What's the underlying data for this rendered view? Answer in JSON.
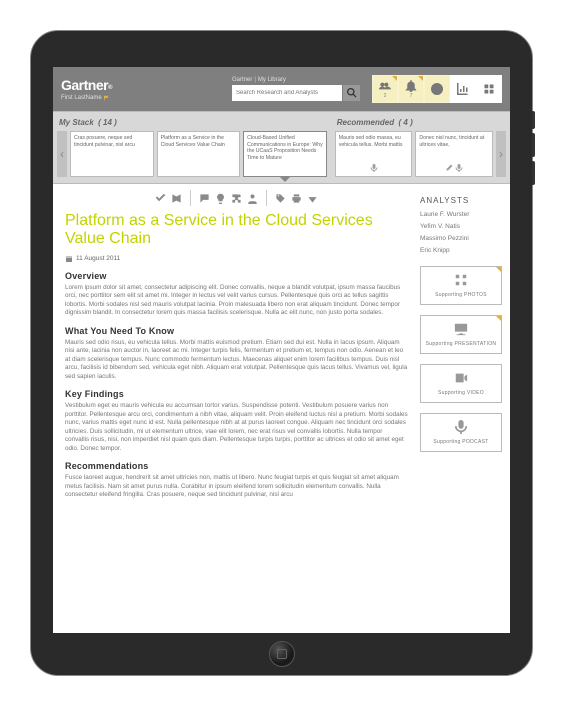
{
  "brand": "Gartner",
  "brandSub": "®",
  "user": "First LastName",
  "breadcrumb": {
    "a": "Gartner",
    "b": "My Library"
  },
  "search": {
    "placeholder": "Search Research and Analysts"
  },
  "topIcons": [
    {
      "name": "people-icon",
      "count": "2"
    },
    {
      "name": "bell-icon",
      "count": "7"
    },
    {
      "name": "clock-icon",
      "count": ""
    },
    {
      "name": "chart-icon",
      "count": ""
    },
    {
      "name": "grid-icon",
      "count": ""
    }
  ],
  "myStack": {
    "title": "My Stack",
    "count": "( 14 )",
    "cards": [
      "Cras posuere, neque sed tincidunt pulvinar, nisl arcu",
      "Platform as a Service in the Cloud Services Value Chain",
      "Cloud-Based Unified Communications in Europe: Why the UCaaS Proposition Needs Time to Mature"
    ]
  },
  "recommended": {
    "title": "Recommended",
    "count": "( 4 )",
    "cards": [
      "Mauris sed odio massa, eu vehicula tellus. Morbi mattis",
      "Donec nisl nunc, tincidunt at ultrices vitae,"
    ]
  },
  "article": {
    "title": "Platform as a Service in the Cloud Services Value Chain",
    "date": "11 August 2011",
    "sections": {
      "overview": {
        "h": "Overview",
        "p": "Lorem ipsum dolor sit amet, consectetur adipiscing elit. Donec convallis, neque a blandit volutpat, ipsum massa faucibus orci, nec porttitor sem elit sit amet mi. Integer in lectus vel velit varius cursus. Pellentesque quis orci ac tellus sagittis lobortis. Morbi sodales nisl sed mauris volutpat lacinia. Proin malesuada libero non erat aliquam tincidunt. Donec tempor dignissim blandit. In consectetur lorem quis massa facilisis scelerisque. Nulla ac elit nunc, non justo porta sodales."
      },
      "whatYouNeed": {
        "h": "What You Need To Know",
        "p": "Mauris sed odio risus, eu vehicula tellus. Morbi mattis euismod pretium. Etiam sed dui est. Nulla in lacus ipsum. Aliquam nisi ante, lacinia non auctor in, laoreet ac mi. Integer turpis felis, fermentum et pretium et, tempus non odio. Aenean et leo at diam scelerisque tempus. Nunc commodo fermentum lectus. Maecenas aliquet enim lorem facilibus tempus. Duis nisl arcu, facilisis id bibendum sed, vehicula eget nibh. Aliquam erat volutpat. Pellentesque quis lacus tellus. Vivamus vel, ligula sed sapien iaculis."
      },
      "keyFindings": {
        "h": "Key Findings",
        "p": "Vestibulum eget eu mauris vehicula eu accumsan tortor varius. Suspendisse potenti. Vestibulum posuere varius non porttitor. Pellentesque arcu orci, condimentum a nibh vitae, aliquam velit. Proin eleifend luctus nisl a pretium. Morbi sodales nunc, varius mattis eget nunc id est. Nulla pellentesque nibh at at purus laoreet congue. Aliquam nec tincidunt orci sodales ultricies. Duis sollicitudin, mi ut elementum ultrice, viae elit lorem, nec erat risus vel convallis lobortis. Nulla tempor convallis risus, nisi, non imperdiet nisl quam quis diam. Pellentesque turpis turpis, porttitor ac ultrices et odio sit amet eget odio. Donec tempor."
      },
      "recommendations": {
        "h": "Recommendations",
        "p": "Fusce laoreet augue, hendrerit sit amet ultricies non, mattis ut libero. Nunc feugiat turpis et quis feugiat sit amet aliquam metus facilisis. Nam sit amet purus nulla. Curabitur in ipsum eleifend lorem sollicitudin elementum convallis. Nulla consectetur eleifend fringilla. Cras posuere, neque sed tincidunt pulvinar, nisl arcu"
      }
    }
  },
  "analysts": {
    "h": "ANALYSTS",
    "list": [
      "Laurie F. Wurster",
      "Yefim V. Natis",
      "Massimo Pezzini",
      "Eric Knipp"
    ]
  },
  "supporting": [
    {
      "label": "Supporting PHOTOS",
      "icon": "grid4"
    },
    {
      "label": "Supporting PRESENTATION",
      "icon": "slides"
    },
    {
      "label": "Supporting VIDEO",
      "icon": "video"
    },
    {
      "label": "Supporting PODCAST",
      "icon": "mic"
    }
  ]
}
